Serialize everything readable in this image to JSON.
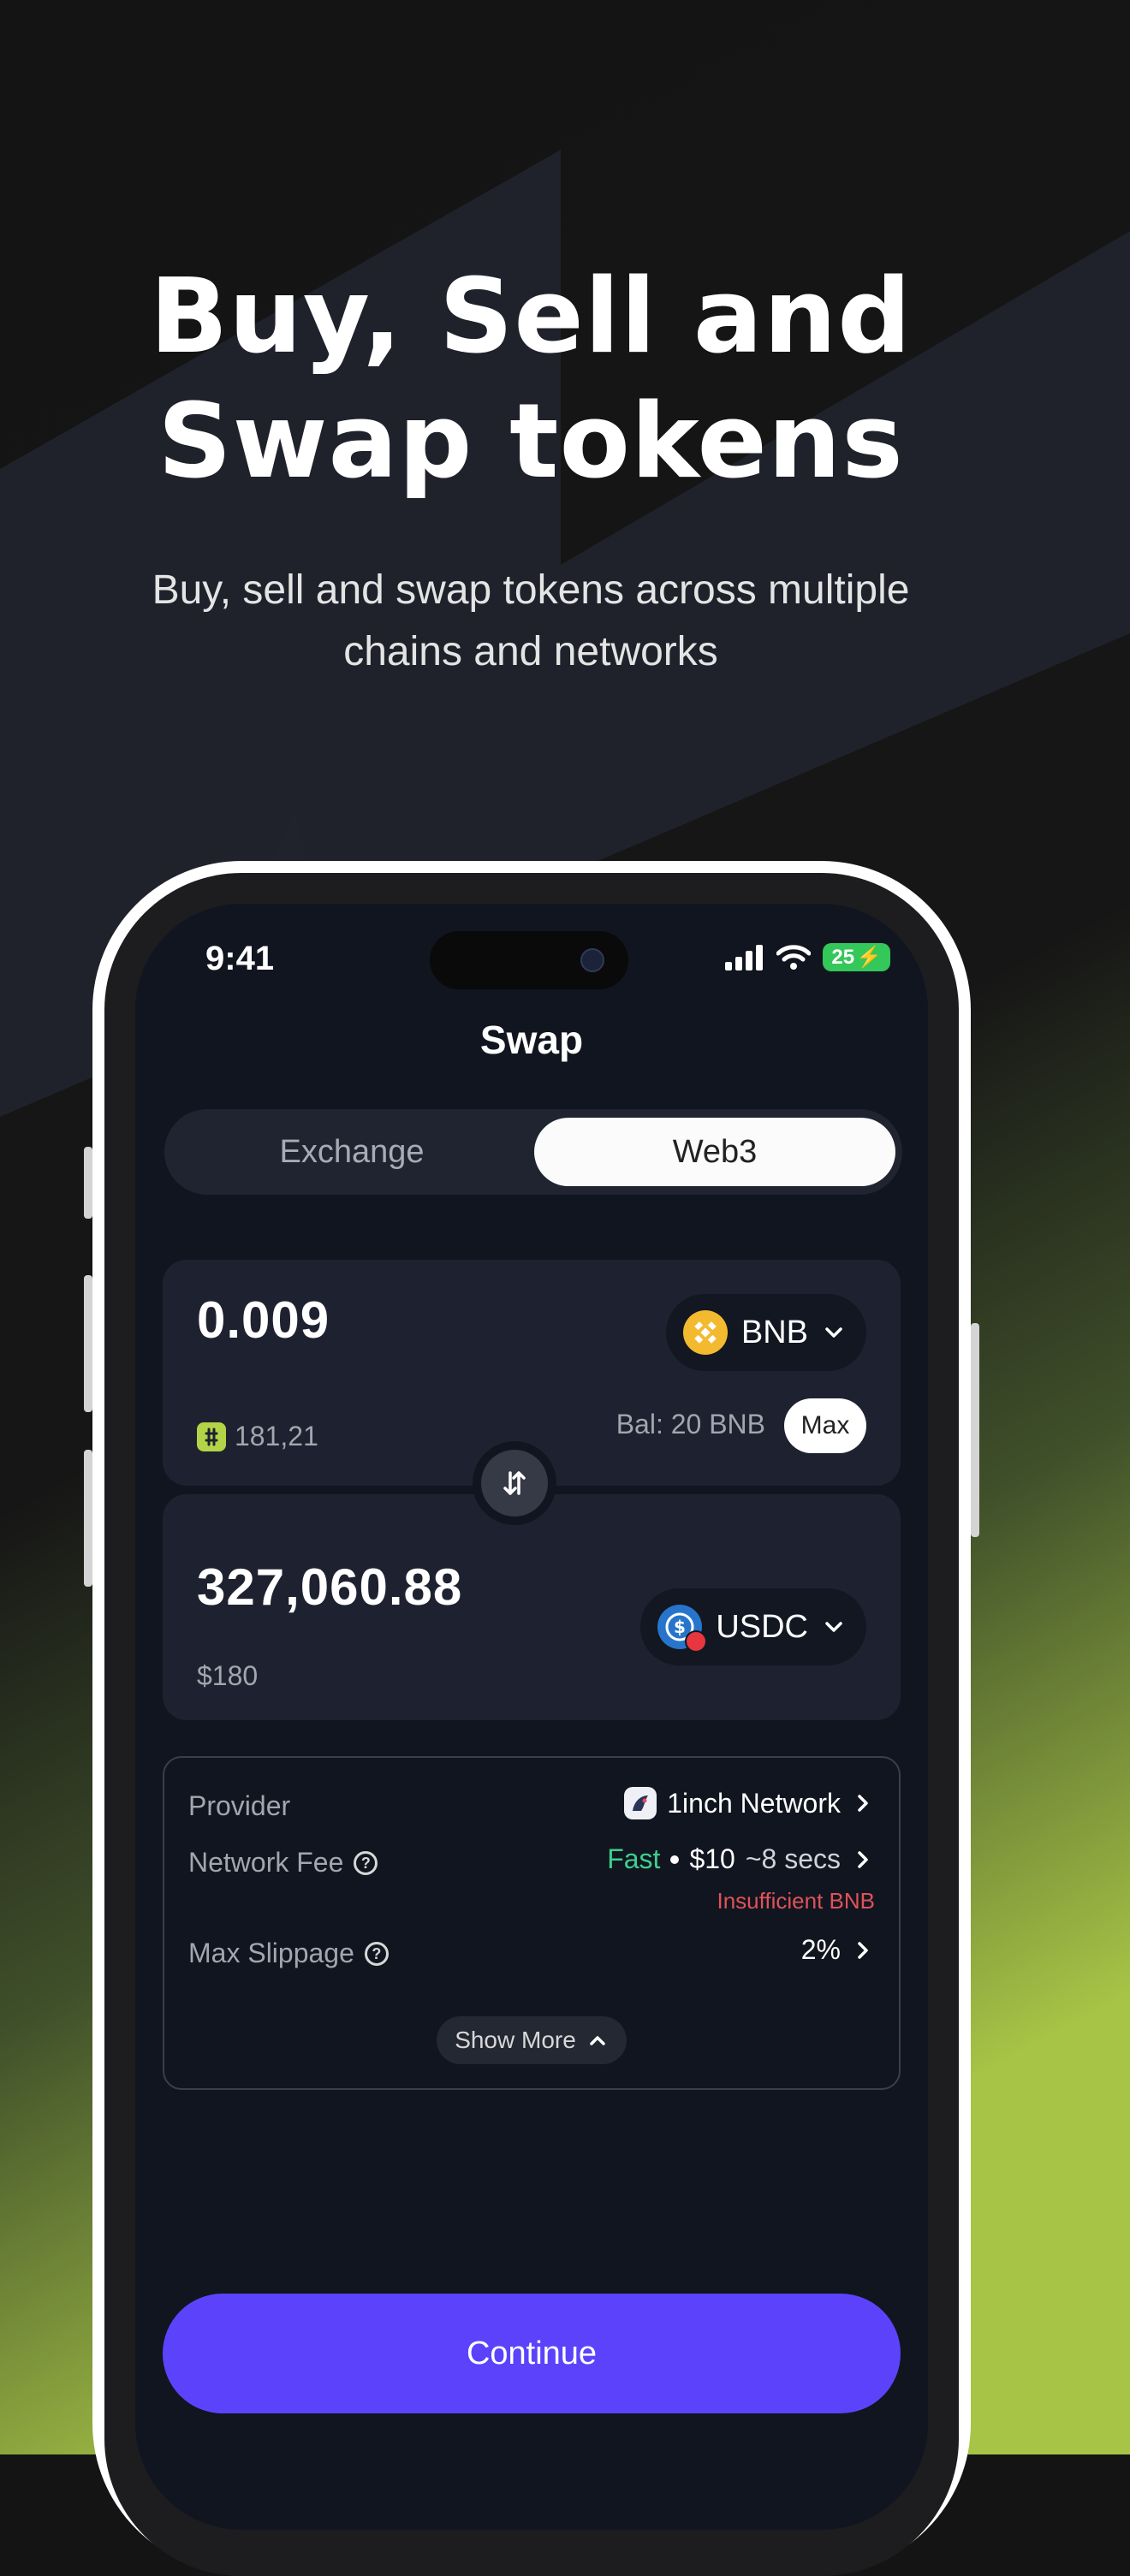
{
  "marketing": {
    "headline_line1": "Buy, Sell and",
    "headline_line2": "Swap tokens",
    "subhead_line1": "Buy, sell and swap tokens across multiple",
    "subhead_line2": "chains and networks"
  },
  "status_bar": {
    "time": "9:41",
    "battery": "25"
  },
  "screen": {
    "title": "Swap",
    "tabs": [
      {
        "label": "Exchange",
        "active": false
      },
      {
        "label": "Web3",
        "active": true
      }
    ]
  },
  "from_card": {
    "amount": "0.009",
    "token": "BNB",
    "fiat_value": "181,21",
    "balance": "Bal: 20 BNB",
    "max_label": "Max"
  },
  "to_card": {
    "amount": "327,060.88",
    "token": "USDC",
    "fiat_value": "$180"
  },
  "details": {
    "provider_label": "Provider",
    "provider_value": "1inch Network",
    "network_fee_label": "Network Fee",
    "fee_speed": "Fast",
    "fee_amount": "$10",
    "fee_time": "~8 secs",
    "fee_warning": "Insufficient BNB",
    "slippage_label": "Max Slippage",
    "slippage_value": "2%",
    "show_more_label": "Show More"
  },
  "continue_label": "Continue",
  "colors": {
    "accent": "#5c43fb",
    "fast_green": "#3ecf8e",
    "warning_red": "#e0525a",
    "bnb_yellow": "#f3ba2f",
    "usdc_blue": "#2775ca",
    "lime": "#b4d447"
  },
  "icons": [
    "signal-icon",
    "wifi-icon",
    "battery-icon",
    "chevron-down-icon",
    "swap-arrows-icon",
    "chevron-right-icon",
    "help-icon",
    "chevron-up-icon"
  ]
}
